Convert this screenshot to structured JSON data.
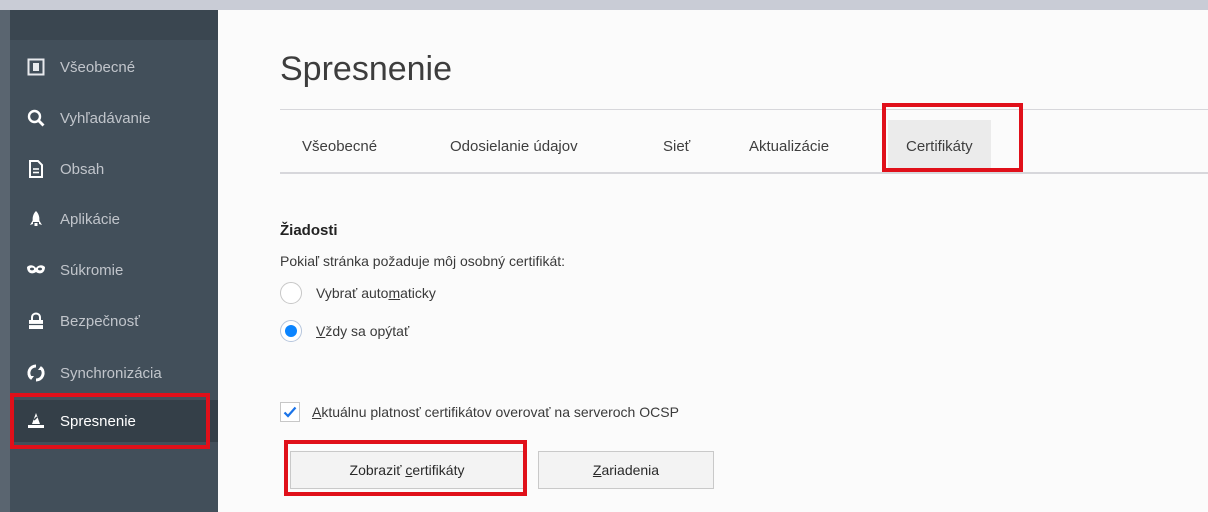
{
  "sidebar": {
    "items": [
      {
        "label": "Všeobecné",
        "icon": "general-icon"
      },
      {
        "label": "Vyhľadávanie",
        "icon": "search-icon"
      },
      {
        "label": "Obsah",
        "icon": "document-icon"
      },
      {
        "label": "Aplikácie",
        "icon": "rocket-icon"
      },
      {
        "label": "Súkromie",
        "icon": "mask-icon"
      },
      {
        "label": "Bezpečnosť",
        "icon": "lock-icon"
      },
      {
        "label": "Synchronizácia",
        "icon": "sync-icon"
      },
      {
        "label": "Spresnenie",
        "icon": "wizard-hat-icon",
        "active": true
      }
    ]
  },
  "main": {
    "title": "Spresnenie",
    "tabs": [
      {
        "label": "Všeobecné"
      },
      {
        "label": "Odosielanie údajov"
      },
      {
        "label": "Sieť"
      },
      {
        "label": "Aktualizácie"
      },
      {
        "label": "Certifikáty",
        "selected": true
      }
    ],
    "requests": {
      "heading": "Žiadosti",
      "description": "Pokiaľ stránka požaduje môj osobný certifikát:",
      "option_auto": {
        "pre": "Vybrať auto",
        "key": "m",
        "post": "aticky",
        "checked": false
      },
      "option_ask": {
        "pre": "",
        "key": "V",
        "post": "ždy sa opýtať",
        "checked": true
      }
    },
    "ocsp": {
      "pre": "",
      "key": "A",
      "post": "ktuálnu platnosť certifikátov overovať na serveroch OCSP",
      "checked": true
    },
    "buttons": {
      "view_certs": {
        "pre": "Zobraziť ",
        "key": "c",
        "post": "ertifikáty"
      },
      "devices": {
        "pre": "",
        "key": "Z",
        "post": "ariadenia"
      }
    }
  },
  "colors": {
    "highlight": "#e0101a",
    "accent": "#0a84ff",
    "sidebar_bg": "#424f5a"
  }
}
